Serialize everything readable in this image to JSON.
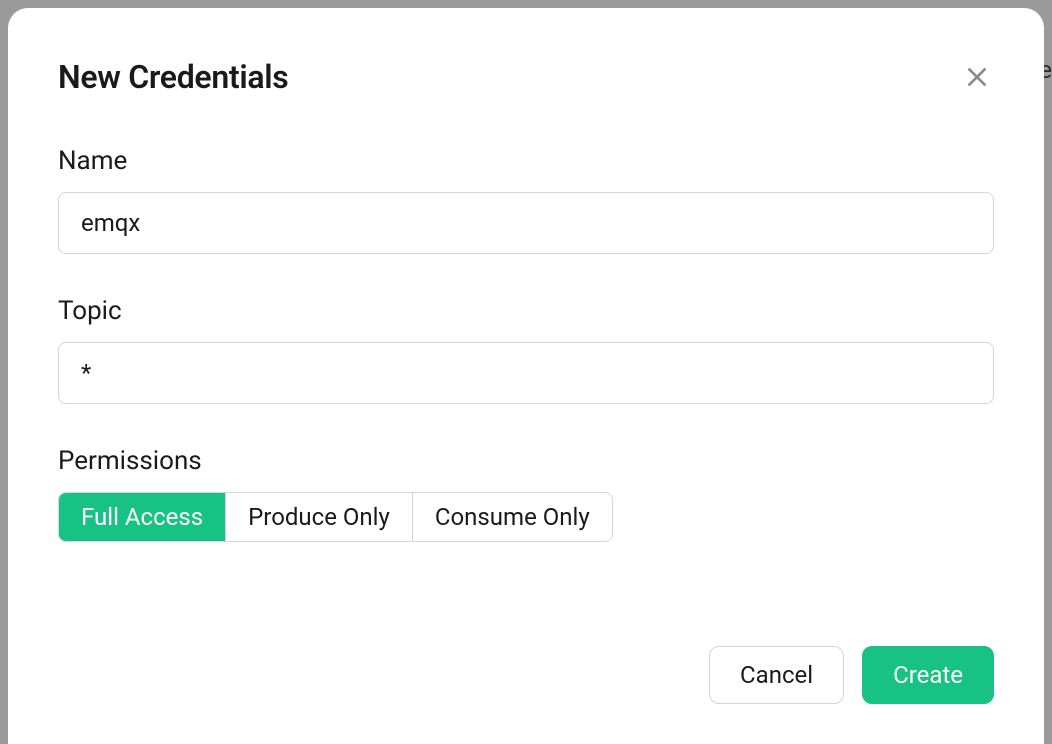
{
  "modal": {
    "title": "New Credentials",
    "fields": {
      "name": {
        "label": "Name",
        "value": "emqx"
      },
      "topic": {
        "label": "Topic",
        "value": "*"
      },
      "permissions": {
        "label": "Permissions",
        "options": {
          "full": "Full Access",
          "produce": "Produce Only",
          "consume": "Consume Only"
        },
        "selected": "full"
      }
    },
    "buttons": {
      "cancel": "Cancel",
      "create": "Create"
    }
  }
}
